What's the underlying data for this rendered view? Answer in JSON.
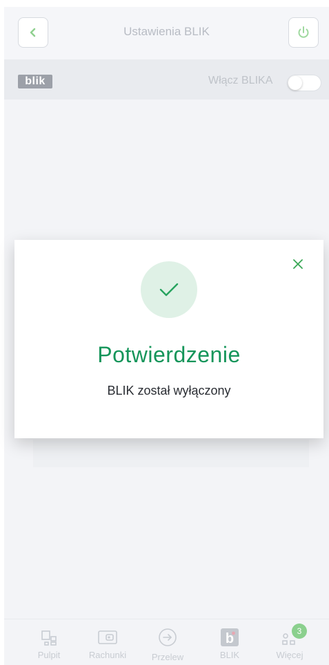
{
  "header": {
    "title": "Ustawienia BLIK",
    "back_icon": "chevron-left-icon",
    "power_icon": "power-icon"
  },
  "blik_row": {
    "logo_text": "blik",
    "toggle_label": "Włącz BLIKA",
    "toggle_on": false
  },
  "modal": {
    "title": "Potwierdzenie",
    "message": "BLIK został wyłączony",
    "close_icon": "close-icon",
    "status_icon": "check-icon"
  },
  "bottom_nav": {
    "items": [
      {
        "label": "Pulpit",
        "icon": "dashboard-icon"
      },
      {
        "label": "Rachunki",
        "icon": "wallet-icon"
      },
      {
        "label": "Przelew",
        "icon": "transfer-icon"
      },
      {
        "label": "BLIK",
        "icon": "blik-icon"
      },
      {
        "label": "Więcej",
        "icon": "more-icon",
        "badge": "3"
      }
    ]
  },
  "colors": {
    "accent_green": "#15955a",
    "check_green": "#27a35f",
    "circle_bg": "#dff1e6"
  }
}
